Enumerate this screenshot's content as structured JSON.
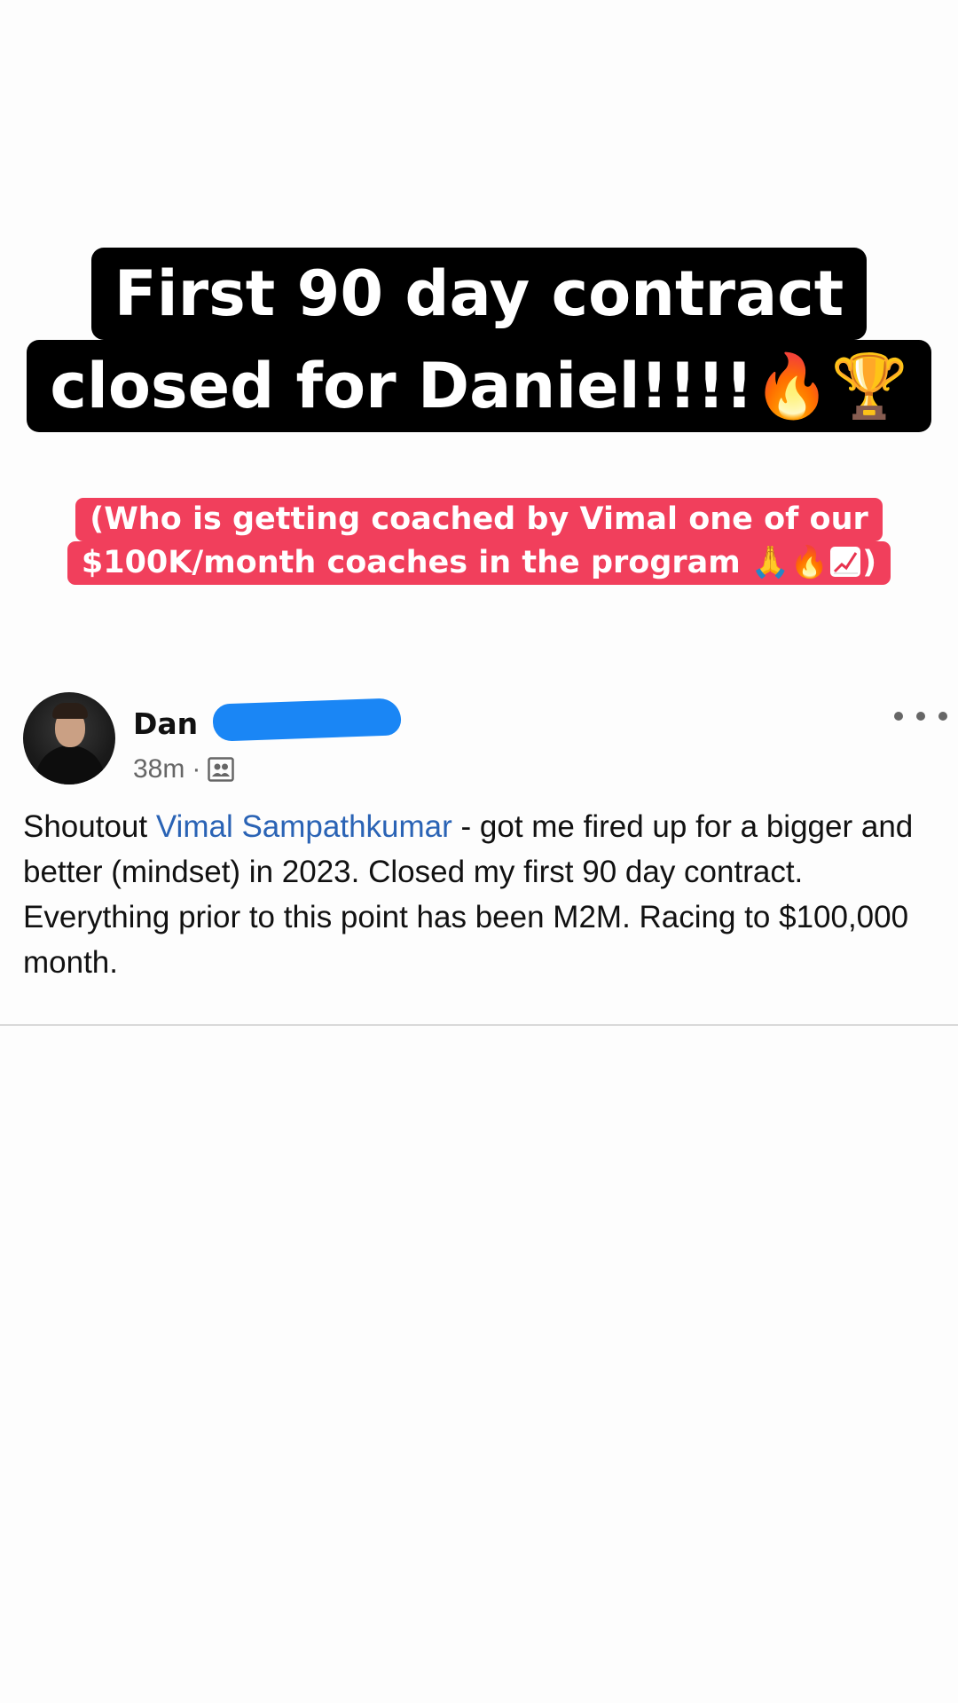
{
  "headline": {
    "line1": "First 90 day contract",
    "line2": "closed for Daniel!!!!"
  },
  "subheadline": {
    "line1": "(Who is getting coached by Vimal one of our",
    "line2": "$100K/month coaches in the program",
    "line2_close": ")"
  },
  "emoji": {
    "fire": "🔥",
    "trophy": "🏆",
    "pray": "🙏",
    "chart": "chart-increasing-icon"
  },
  "colors": {
    "headline_bg": "#000000",
    "subhead_bg": "#f13f5c",
    "mention": "#2a63b5",
    "redaction": "#1a86f5"
  },
  "post": {
    "author_visible": "Dan",
    "time": "38m",
    "separator": "·",
    "body_before": "Shoutout ",
    "mention": "Vimal Sampathkumar",
    "body_after": " - got me fired up for a bigger and better (mindset) in 2023. Closed my first 90 day contract. Everything prior to this point has been M2M. Racing to $100,000 month."
  }
}
